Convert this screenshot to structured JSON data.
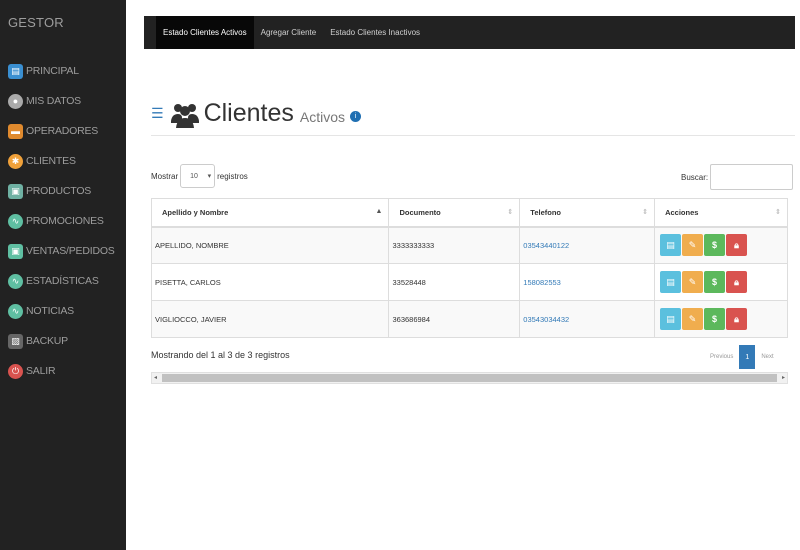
{
  "sidebar": {
    "brand": "GESTOR",
    "items": [
      {
        "label": "PRINCIPAL",
        "icon": "home-icon",
        "color": "#3a8fd1"
      },
      {
        "label": "MIS DATOS",
        "icon": "user-icon",
        "color": "#aaaaaa"
      },
      {
        "label": "OPERADORES",
        "icon": "briefcase-icon",
        "color": "#e08a2e"
      },
      {
        "label": "CLIENTES",
        "icon": "person-icon",
        "color": "#f0a13a"
      },
      {
        "label": "PRODUCTOS",
        "icon": "box-icon",
        "color": "#6fb1a3"
      },
      {
        "label": "PROMOCIONES",
        "icon": "wave-icon",
        "color": "#5fbfa2"
      },
      {
        "label": "VENTAS/PEDIDOS",
        "icon": "cart-icon",
        "color": "#5fbfa2"
      },
      {
        "label": "ESTADÍSTICAS",
        "icon": "chart-icon",
        "color": "#5fbfa2"
      },
      {
        "label": "NOTICIAS",
        "icon": "news-icon",
        "color": "#5fbfa2"
      },
      {
        "label": "BACKUP",
        "icon": "backup-icon",
        "color": "#666666"
      },
      {
        "label": "SALIR",
        "icon": "power-icon",
        "color": "#d9534f"
      }
    ]
  },
  "topnav": {
    "tabs": [
      "Estado Clientes Activos",
      "Agregar Cliente",
      "Estado Clientes Inactivos"
    ]
  },
  "header": {
    "title": "Clientes",
    "subtitle": "Activos",
    "badge": "i"
  },
  "length": {
    "prefix": "Mostrar",
    "value": "10",
    "suffix": "registros"
  },
  "search": {
    "label": "Buscar:"
  },
  "table": {
    "columns": [
      "Apellido y Nombre",
      "Documento",
      "Telefono",
      "Acciones"
    ],
    "rows": [
      {
        "name": "APELLIDO, NOMBRE",
        "doc": "3333333333",
        "phone": "03543440122"
      },
      {
        "name": "PISETTA, CARLOS",
        "doc": "33528448",
        "phone": "158082553"
      },
      {
        "name": "VIGLIOCCO, JAVIER",
        "doc": "363686984",
        "phone": "03543034432"
      }
    ]
  },
  "footer": {
    "info": "Mostrando del 1 al 3 de 3 registros",
    "prev": "Previous",
    "page": "1",
    "next": "Next"
  },
  "colors": {
    "accent": "#337ab7",
    "sidebar_bg": "#222222"
  }
}
